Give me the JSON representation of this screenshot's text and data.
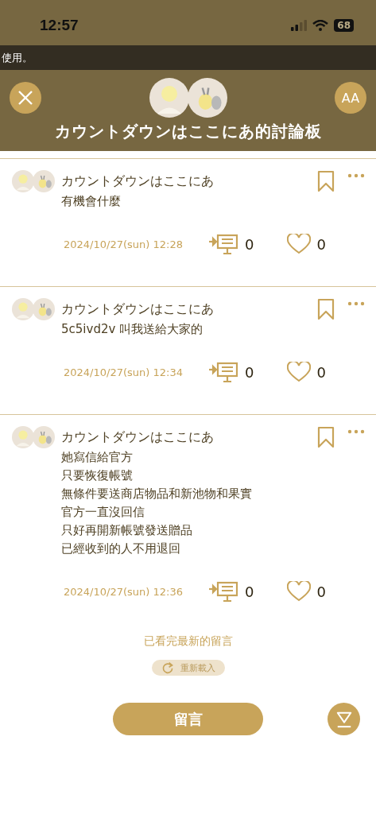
{
  "status_bar": {
    "time": "12:57",
    "battery": "68"
  },
  "banner": {
    "text": "使用。"
  },
  "header": {
    "title": "カウントダウンはここにあ的討論板",
    "font_button": "AA"
  },
  "posts": [
    {
      "author": "カウントダウンはここにあ",
      "lines": [
        "有機會什麼"
      ],
      "date": "2024/10/27(sun) 12:28",
      "replies": "0",
      "likes": "0"
    },
    {
      "author": "カウントダウンはここにあ",
      "lines": [
        "5c5ivd2v 叫我送給大家的"
      ],
      "date": "2024/10/27(sun) 12:34",
      "replies": "0",
      "likes": "0"
    },
    {
      "author": "カウントダウンはここにあ",
      "lines": [
        "她寫信給官方",
        "只要恢復帳號",
        "無條件要送商店物品和新池物和果實",
        "官方一直沒回信",
        "只好再開新帳號發送贈品",
        "已經收到的人不用退回"
      ],
      "date": "2024/10/27(sun) 12:36",
      "replies": "0",
      "likes": "0"
    }
  ],
  "end_notice": "已看完最新的留言",
  "reload_button": "重新載入",
  "comment_button": "留言"
}
